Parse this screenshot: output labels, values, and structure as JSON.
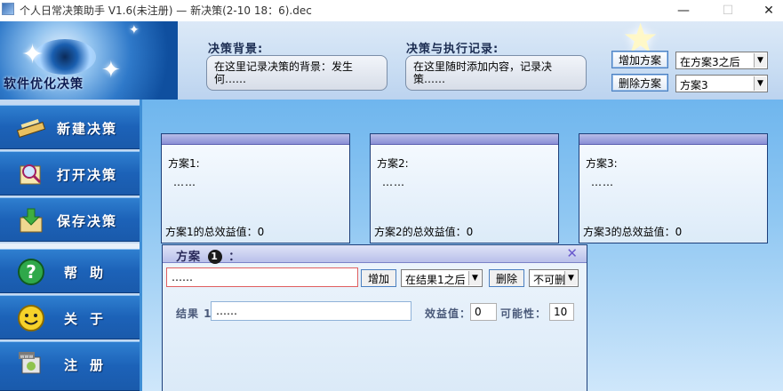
{
  "window": {
    "title": "个人日常决策助手 V1.6(未注册) — 新决策(2-10 18：6).dec",
    "minimize": "—",
    "maximize": "☐",
    "close": "✕"
  },
  "logo": {
    "text": "软件优化决策"
  },
  "header": {
    "background_label": "决策背景:",
    "background_text": "在这里记录决策的背景：发生何……",
    "record_label": "决策与执行记录:",
    "record_text": "在这里随时添加内容，记录决策……",
    "add_plan_button": "增加方案",
    "add_position_select": "在方案3之后",
    "delete_plan_button": "删除方案",
    "delete_select": "方案3"
  },
  "sidebar": {
    "items": [
      {
        "label": "新建决策",
        "icon": "pencil-icon"
      },
      {
        "label": "打开决策",
        "icon": "magnifier-icon"
      },
      {
        "label": "保存决策",
        "icon": "save-arrow-icon"
      },
      {
        "label": "帮助",
        "icon": "question-icon"
      },
      {
        "label": "关于",
        "icon": "smiley-icon"
      },
      {
        "label": "注册",
        "icon": "www-icon"
      }
    ]
  },
  "plans": [
    {
      "name": "方案1:",
      "content": "……",
      "total": "方案1的总效益值：0"
    },
    {
      "name": "方案2:",
      "content": "……",
      "total": "方案2的总效益值：0"
    },
    {
      "name": "方案3:",
      "content": "……",
      "total": "方案3的总效益值：0"
    }
  ],
  "detail": {
    "title_prefix": "方案",
    "number": "1",
    "title_suffix": "：",
    "close_icon": "✕",
    "input_value": "……",
    "add_button": "增加",
    "position_select": "在结果1之后",
    "delete_button": "删除",
    "possibility_select": "不可删",
    "result_label": "结果 1",
    "result_value": "……",
    "benefit_label": "效益值：",
    "benefit_value": "0",
    "possibility_label": "可能性：",
    "possibility_value": "10"
  }
}
